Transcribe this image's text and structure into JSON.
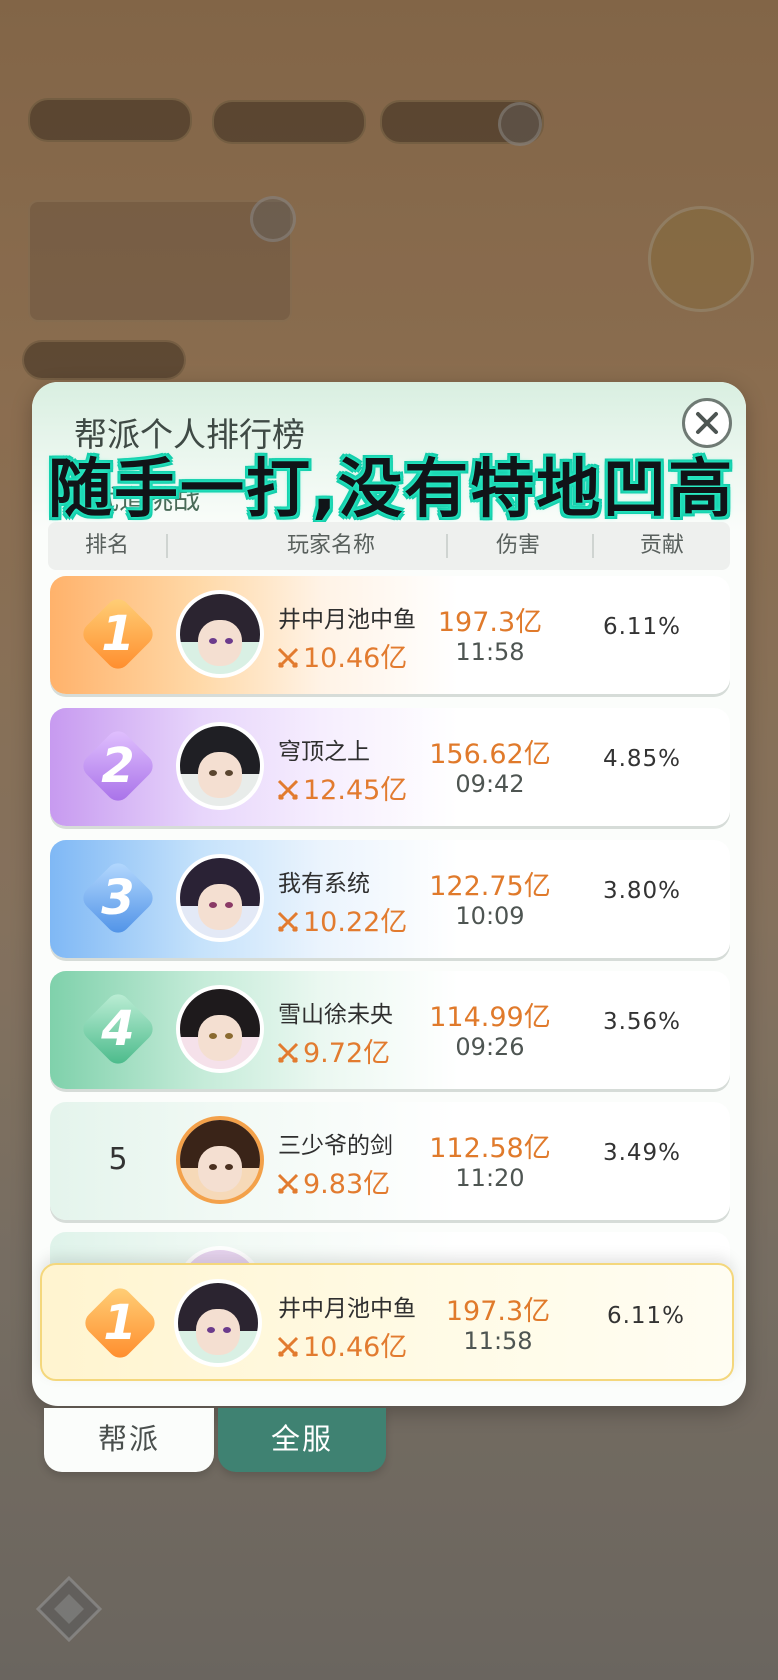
{
  "modal": {
    "title": "帮派个人排行榜",
    "subtitle": "武道挑战",
    "overlay_caption": "随手一打,没有特地凹高"
  },
  "table": {
    "headers": [
      "排名",
      "玩家名称",
      "伤害",
      "贡献"
    ]
  },
  "rows": [
    {
      "rank": "1",
      "name": "井中月池中鱼",
      "power": "10.46亿",
      "damage": "197.3亿",
      "time": "11:58",
      "contribution": "6.11%"
    },
    {
      "rank": "2",
      "name": "穹顶之上",
      "power": "12.45亿",
      "damage": "156.62亿",
      "time": "09:42",
      "contribution": "4.85%"
    },
    {
      "rank": "3",
      "name": "我有系统",
      "power": "10.22亿",
      "damage": "122.75亿",
      "time": "10:09",
      "contribution": "3.80%"
    },
    {
      "rank": "4",
      "name": "雪山徐未央",
      "power": "9.72亿",
      "damage": "114.99亿",
      "time": "09:26",
      "contribution": "3.56%"
    },
    {
      "rank": "5",
      "name": "三少爷的剑",
      "power": "9.83亿",
      "damage": "112.58亿",
      "time": "11:20",
      "contribution": "3.49%"
    }
  ],
  "self_row": {
    "rank": "1",
    "name": "井中月池中鱼",
    "power": "10.46亿",
    "damage": "197.3亿",
    "time": "11:58",
    "contribution": "6.11%"
  },
  "tabs": {
    "guild": "帮派",
    "server": "全服"
  },
  "colors": {
    "accent_orange": "#e07a2b",
    "tab_active": "#3f8272",
    "caption_glow": "#12c9a8"
  }
}
